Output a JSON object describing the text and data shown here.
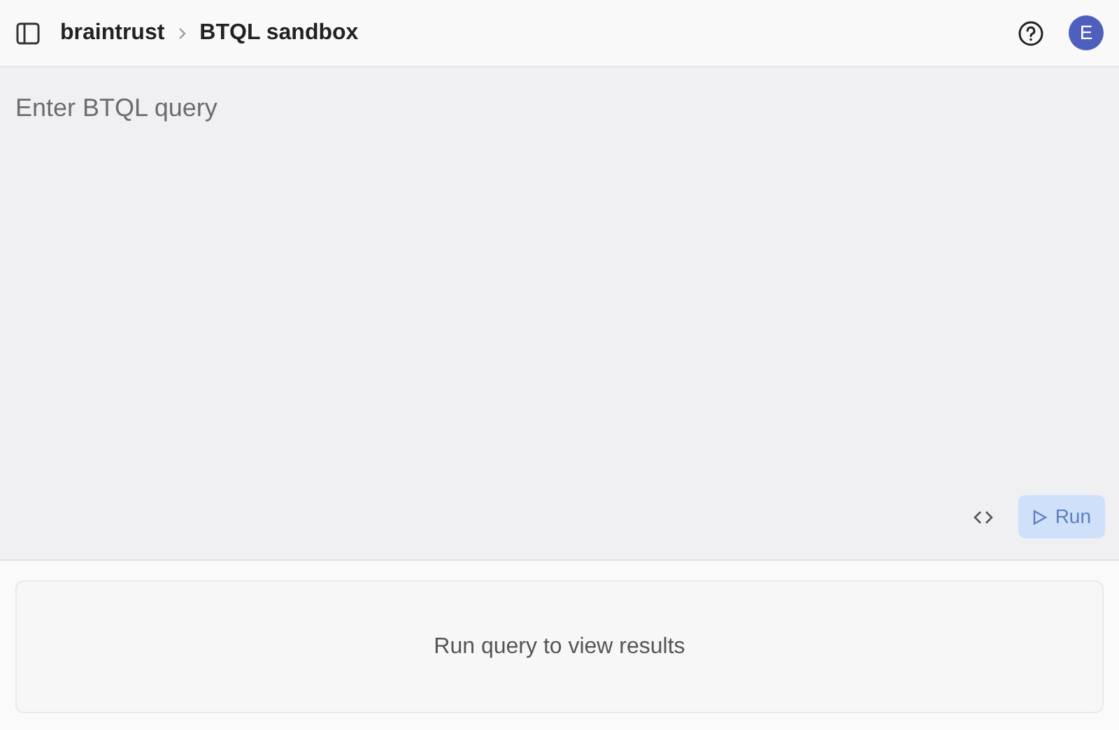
{
  "header": {
    "breadcrumb": [
      "braintrust",
      "BTQL sandbox"
    ],
    "avatar": "E"
  },
  "editor": {
    "placeholder": "Enter BTQL query",
    "run_button": {
      "label": "Run",
      "disabled": true
    }
  },
  "results": {
    "empty_text": "Run query to view results"
  }
}
